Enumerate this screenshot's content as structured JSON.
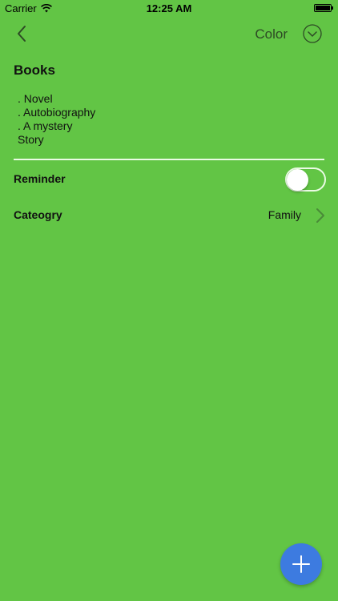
{
  "status_bar": {
    "carrier": "Carrier",
    "time": "12:25 AM",
    "wifi_icon": "wifi-icon",
    "battery_icon": "battery-icon"
  },
  "nav": {
    "back_icon": "chevron-left-icon",
    "color_label": "Color",
    "color_icon": "chevron-down-circle-icon"
  },
  "note": {
    "title": "Books",
    "body": ". Novel\n. Autobiography\n. A mystery\nStory"
  },
  "reminder": {
    "label": "Reminder",
    "enabled": false
  },
  "category": {
    "label": "Cateogry",
    "value": "Family",
    "chevron_icon": "chevron-right-icon"
  },
  "fab": {
    "icon": "plus-icon",
    "color": "#3d7be0"
  },
  "colors": {
    "background": "#62c545",
    "divider": "#eafbe4",
    "accent": "#3d7be0"
  }
}
